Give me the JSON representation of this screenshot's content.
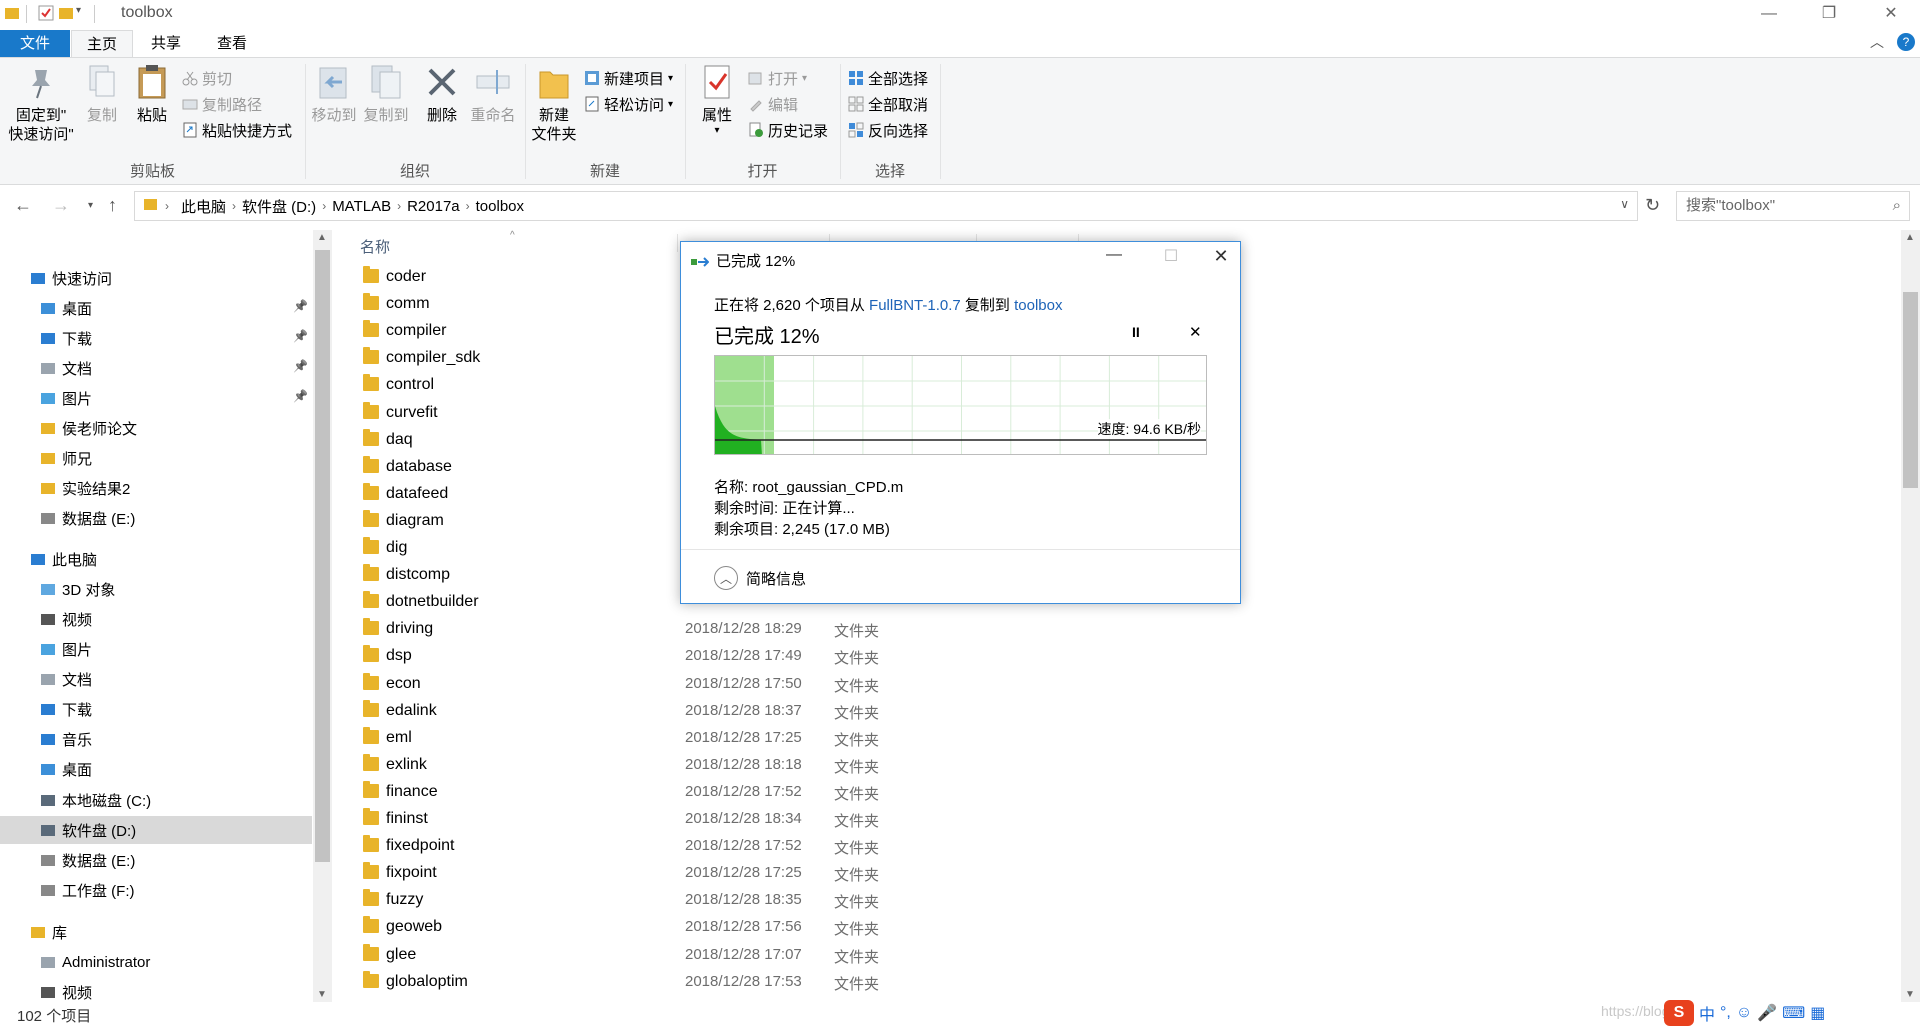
{
  "window": {
    "title": "toolbox",
    "minimize": "—",
    "restore": "❐",
    "close": "✕",
    "help": "?",
    "collapse": "︿"
  },
  "ribbon": {
    "tabs": [
      "文件",
      "主页",
      "共享",
      "查看"
    ],
    "clipboard": {
      "pin_label_1": "固定到\"",
      "pin_label_2": "快速访问\"",
      "copy": "复制",
      "paste": "粘贴",
      "cut": "剪切",
      "copy_path": "复制路径",
      "paste_shortcut": "粘贴快捷方式",
      "group": "剪贴板"
    },
    "organize": {
      "move_to": "移动到",
      "copy_to": "复制到",
      "delete": "删除",
      "rename": "重命名",
      "group": "组织"
    },
    "new": {
      "new_folder_1": "新建",
      "new_folder_2": "文件夹",
      "new_item": "新建项目",
      "easy_access": "轻松访问",
      "group": "新建"
    },
    "open": {
      "properties": "属性",
      "open": "打开",
      "edit": "编辑",
      "history": "历史记录",
      "group": "打开"
    },
    "select": {
      "select_all": "全部选择",
      "select_none": "全部取消",
      "invert": "反向选择",
      "group": "选择"
    }
  },
  "address": {
    "crumbs": [
      "此电脑",
      "软件盘 (D:)",
      "MATLAB",
      "R2017a",
      "toolbox"
    ],
    "search_placeholder": "搜索\"toolbox\""
  },
  "navpane": {
    "items": [
      {
        "label": "快速访问",
        "pinned": false
      },
      {
        "label": "桌面",
        "pinned": true
      },
      {
        "label": "下载",
        "pinned": true
      },
      {
        "label": "文档",
        "pinned": true
      },
      {
        "label": "图片",
        "pinned": true
      },
      {
        "label": "侯老师论文",
        "pinned": false
      },
      {
        "label": "师兄",
        "pinned": false
      },
      {
        "label": "实验结果2",
        "pinned": false
      },
      {
        "label": "数据盘 (E:)",
        "pinned": false
      },
      {
        "label": "此电脑",
        "pinned": false
      },
      {
        "label": "3D 对象",
        "pinned": false
      },
      {
        "label": "视频",
        "pinned": false
      },
      {
        "label": "图片",
        "pinned": false
      },
      {
        "label": "文档",
        "pinned": false
      },
      {
        "label": "下载",
        "pinned": false
      },
      {
        "label": "音乐",
        "pinned": false
      },
      {
        "label": "桌面",
        "pinned": false
      },
      {
        "label": "本地磁盘 (C:)",
        "pinned": false
      },
      {
        "label": "软件盘 (D:)",
        "pinned": false,
        "selected": true
      },
      {
        "label": "数据盘 (E:)",
        "pinned": false
      },
      {
        "label": "工作盘 (F:)",
        "pinned": false
      },
      {
        "label": "库",
        "pinned": false
      },
      {
        "label": "Administrator",
        "pinned": false
      },
      {
        "label": "视频",
        "pinned": false
      }
    ]
  },
  "filelist": {
    "col_name": "名称",
    "rows": [
      {
        "name": "coder",
        "date": "",
        "type": ""
      },
      {
        "name": "comm",
        "date": "",
        "type": ""
      },
      {
        "name": "compiler",
        "date": "",
        "type": ""
      },
      {
        "name": "compiler_sdk",
        "date": "",
        "type": ""
      },
      {
        "name": "control",
        "date": "",
        "type": ""
      },
      {
        "name": "curvefit",
        "date": "",
        "type": ""
      },
      {
        "name": "daq",
        "date": "",
        "type": ""
      },
      {
        "name": "database",
        "date": "",
        "type": ""
      },
      {
        "name": "datafeed",
        "date": "",
        "type": ""
      },
      {
        "name": "diagram",
        "date": "",
        "type": ""
      },
      {
        "name": "dig",
        "date": "",
        "type": ""
      },
      {
        "name": "distcomp",
        "date": "",
        "type": ""
      },
      {
        "name": "dotnetbuilder",
        "date": "",
        "type": ""
      },
      {
        "name": "driving",
        "date": "2018/12/28 18:29",
        "type": "文件夹"
      },
      {
        "name": "dsp",
        "date": "2018/12/28 17:49",
        "type": "文件夹"
      },
      {
        "name": "econ",
        "date": "2018/12/28 17:50",
        "type": "文件夹"
      },
      {
        "name": "edalink",
        "date": "2018/12/28 18:37",
        "type": "文件夹"
      },
      {
        "name": "eml",
        "date": "2018/12/28 17:25",
        "type": "文件夹"
      },
      {
        "name": "exlink",
        "date": "2018/12/28 18:18",
        "type": "文件夹"
      },
      {
        "name": "finance",
        "date": "2018/12/28 17:52",
        "type": "文件夹"
      },
      {
        "name": "fininst",
        "date": "2018/12/28 18:34",
        "type": "文件夹"
      },
      {
        "name": "fixedpoint",
        "date": "2018/12/28 17:52",
        "type": "文件夹"
      },
      {
        "name": "fixpoint",
        "date": "2018/12/28 17:25",
        "type": "文件夹"
      },
      {
        "name": "fuzzy",
        "date": "2018/12/28 18:35",
        "type": "文件夹"
      },
      {
        "name": "geoweb",
        "date": "2018/12/28 17:56",
        "type": "文件夹"
      },
      {
        "name": "glee",
        "date": "2018/12/28 17:07",
        "type": "文件夹"
      },
      {
        "name": "globaloptim",
        "date": "2018/12/28 17:53",
        "type": "文件夹"
      }
    ]
  },
  "status": {
    "count": "102 个项目",
    "watermark": "https://blog.c"
  },
  "ime": {
    "lang": "中",
    "punct": "°,",
    "emoji": "☺",
    "mic": "🎤",
    "keyboard": "⌨",
    "grid": "▦"
  },
  "dialog": {
    "title": "已完成 12%",
    "desc_prefix": "正在将 2,620 个项目从 ",
    "desc_src": "FullBNT-1.0.7",
    "desc_mid": " 复制到 ",
    "desc_dst": "toolbox",
    "percent_text": "已完成 12%",
    "progress": 0.12,
    "pause": "II",
    "stop": "✕",
    "speed": "速度: 94.6 KB/秒",
    "name_line": "名称:  root_gaussian_CPD.m",
    "time_line": "剩余时间:  正在计算...",
    "items_line": "剩余项目:  2,245 (17.0 MB)",
    "more_info": "简略信息",
    "more_icon": "︿",
    "minimize": "—",
    "maximize": "☐",
    "close": "✕"
  },
  "colors": {
    "accent": "#1979ca",
    "graph_fill": "#21b021",
    "graph_progress": "#9fdf8f",
    "link": "#1d63b7",
    "folder": "#e8b42a"
  }
}
